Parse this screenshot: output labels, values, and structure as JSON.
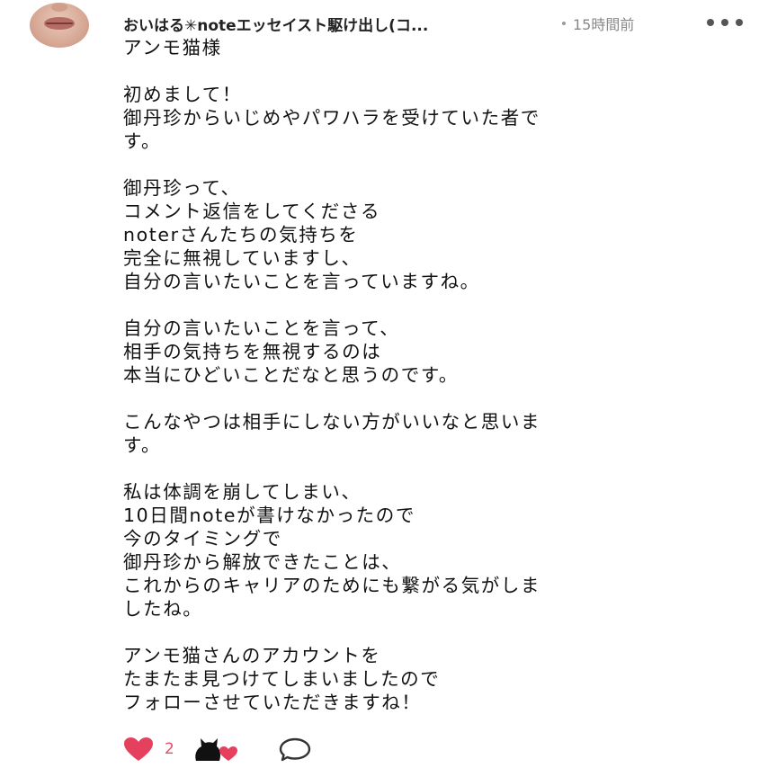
{
  "comment": {
    "author": "おいはる✳︎noteエッセイスト駆け出し(コ...",
    "time": "15時間前",
    "paragraphs": [
      [
        "アンモ猫様"
      ],
      [
        "初めまして！",
        "御丹珍からいじめやパワハラを受けていた者で",
        "す。"
      ],
      [
        "御丹珍って、",
        "コメント返信をしてくださる",
        "noterさんたちの気持ちを",
        "完全に無視していますし、",
        "自分の言いたいことを言っていますね。"
      ],
      [
        "自分の言いたいことを言って、",
        "相手の気持ちを無視するのは",
        "本当にひどいことだなと思うのです。"
      ],
      [
        "こんなやつは相手にしない方がいいなと思いま",
        "す。"
      ],
      [
        "私は体調を崩してしまい、",
        "10日間noteが書けなかったので",
        "今のタイミングで",
        "御丹珍から解放できたことは、",
        "これからのキャリアのためにも繋がる気がしま",
        "したね。"
      ],
      [
        "アンモ猫さんのアカウントを",
        "たまたま見つけてしまいましたので",
        "フォローさせていただきますね！"
      ]
    ],
    "likes": "2"
  },
  "colors": {
    "heart": "#e6405f",
    "count": "#e74c6a",
    "text": "#111111",
    "muted": "#888888"
  },
  "icons": {
    "like": "heart-icon",
    "supporter": "cat-heart-icon",
    "reply": "speech-bubble-icon",
    "more": "more-dots-icon"
  }
}
